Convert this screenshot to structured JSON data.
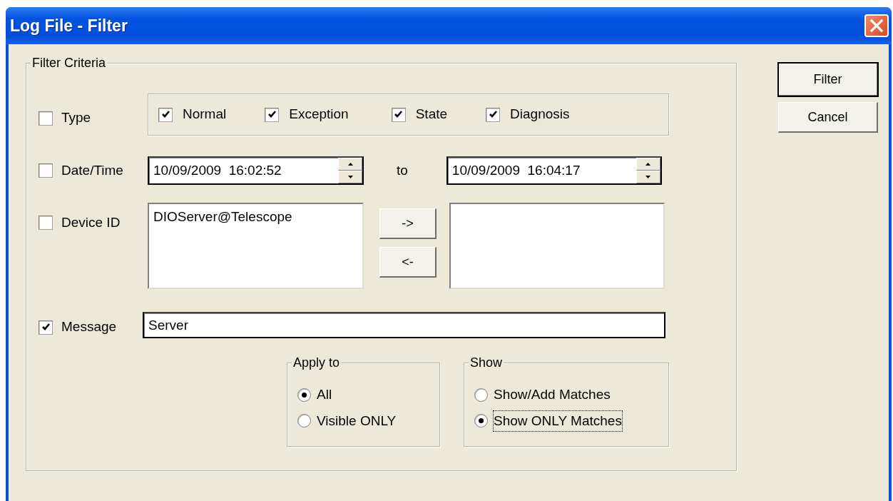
{
  "window": {
    "title": "Log File - Filter"
  },
  "filter_criteria": {
    "title": "Filter Criteria",
    "type": {
      "label": "Type",
      "checked": false,
      "options": [
        {
          "label": "Normal",
          "checked": true
        },
        {
          "label": "Exception",
          "checked": true
        },
        {
          "label": "State",
          "checked": true
        },
        {
          "label": "Diagnosis",
          "checked": true
        }
      ]
    },
    "date_time": {
      "label": "Date/Time",
      "checked": false,
      "from": "10/09/2009  16:02:52",
      "separator": "to",
      "to": "10/09/2009  16:04:17"
    },
    "device_id": {
      "label": "Device ID",
      "checked": false,
      "available": [
        "DIOServer@Telescope"
      ],
      "buttons": [
        "->",
        "<-"
      ]
    },
    "message": {
      "label": "Message",
      "checked": true,
      "value": "Server"
    },
    "apply_to": {
      "title": "Apply to",
      "options": [
        {
          "label": "All",
          "selected": true,
          "focused": false
        },
        {
          "label": "Visible ONLY",
          "selected": false,
          "focused": false
        }
      ]
    },
    "show": {
      "title": "Show",
      "options": [
        {
          "label": "Show/Add Matches",
          "selected": false,
          "focused": false
        },
        {
          "label": "Show ONLY Matches",
          "selected": true,
          "focused": true
        }
      ]
    }
  },
  "buttons": [
    {
      "label": "Filter",
      "default": true
    },
    {
      "label": "Cancel",
      "default": false
    }
  ]
}
